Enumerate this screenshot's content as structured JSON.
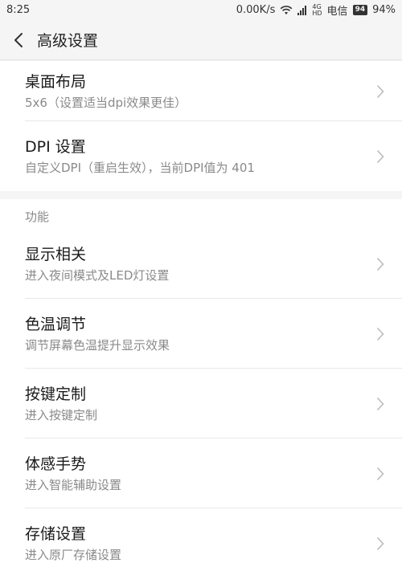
{
  "status_bar": {
    "time": "8:25",
    "net_speed": "0.00K/s",
    "carrier": "电信",
    "battery_icon_text": "94",
    "battery": "94%",
    "signal_small_top": "4G",
    "signal_small_bottom": "HD"
  },
  "header": {
    "title": "高级设置"
  },
  "group1": {
    "items": [
      {
        "title": "桌面布局",
        "subtitle": "5x6（设置适当dpi效果更佳）"
      },
      {
        "title": "DPI 设置",
        "subtitle": "自定义DPI（重启生效），当前DPI值为 401"
      }
    ]
  },
  "group2": {
    "header": "功能",
    "items": [
      {
        "title": "显示相关",
        "subtitle": "进入夜间模式及LED灯设置"
      },
      {
        "title": "色温调节",
        "subtitle": "调节屏幕色温提升显示效果"
      },
      {
        "title": "按键定制",
        "subtitle": "进入按键定制"
      },
      {
        "title": "体感手势",
        "subtitle": "进入智能辅助设置"
      },
      {
        "title": "存储设置",
        "subtitle": "进入原厂存储设置"
      }
    ]
  },
  "icons": {
    "back": "back-arrow-icon",
    "chevron": "chevron-right-icon",
    "wifi": "wifi-icon",
    "battery": "battery-icon"
  }
}
